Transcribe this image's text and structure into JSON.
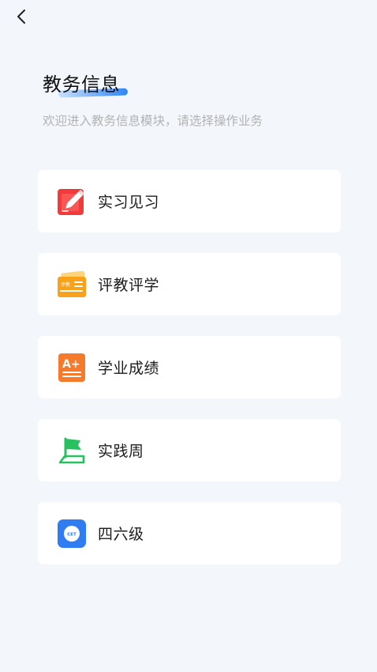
{
  "header": {
    "back_icon": "chevron-left-icon",
    "title": "教务信息",
    "subtitle": "欢迎进入教务信息模块，请选择操作业务",
    "accent_color": "#2f86f5"
  },
  "menu": [
    {
      "label": "实习见习",
      "icon": "pencil-note-icon",
      "color": "#f23a3a"
    },
    {
      "label": "评教评学",
      "icon": "evaluation-card-icon",
      "color": "#f7a21a",
      "icon_text": "评教"
    },
    {
      "label": "学业成绩",
      "icon": "grade-a-plus-icon",
      "color": "#f67a2c",
      "icon_text": "A+"
    },
    {
      "label": "实践周",
      "icon": "flag-icon",
      "color": "#27c25f"
    },
    {
      "label": "四六级",
      "icon": "cet-icon",
      "color": "#2f7df1",
      "icon_text": "CET"
    }
  ]
}
